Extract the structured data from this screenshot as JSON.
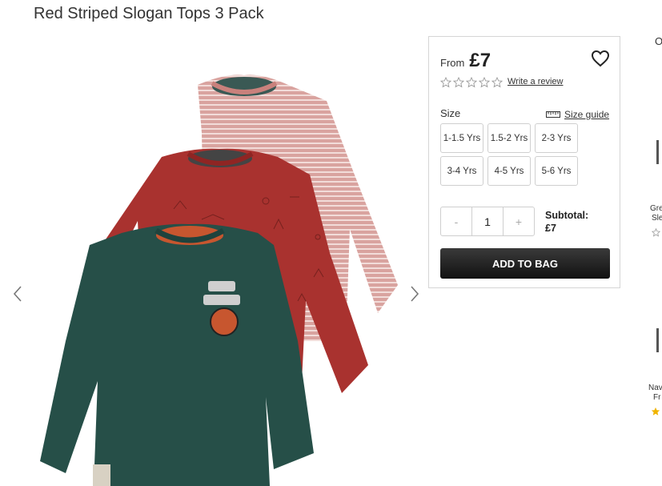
{
  "product": {
    "title": "Red Striped Slogan Tops 3 Pack",
    "from_label": "From",
    "price": "£7"
  },
  "reviews": {
    "rating": 0,
    "max": 5,
    "write_label": "Write a review"
  },
  "size": {
    "label": "Size",
    "guide_label": "Size guide",
    "options": [
      "1-1.5 Yrs",
      "1.5-2 Yrs",
      "2-3 Yrs",
      "3-4 Yrs",
      "4-5 Yrs",
      "5-6 Yrs"
    ]
  },
  "quantity": {
    "minus": "-",
    "value": "1",
    "plus": "+"
  },
  "subtotal": {
    "label": "Subtotal:",
    "value": "£7"
  },
  "cta": {
    "add_to_bag": "ADD TO BAG"
  },
  "side_panel": {
    "header_char": "O",
    "item1_line1": "Gre",
    "item1_line2": "Sle",
    "item2_line1": "Nav",
    "item2_line2": "Fr"
  },
  "colors": {
    "button_dark": "#1a1a1a",
    "star_gold": "#f0b400",
    "border": "#d5d5d5"
  },
  "icons": {
    "prev": "chevron-left-icon",
    "next": "chevron-right-icon",
    "wishlist": "heart-icon",
    "ruler": "ruler-icon"
  }
}
